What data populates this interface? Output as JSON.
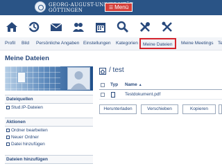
{
  "header": {
    "university_name_line1": "GEORG-AUGUST-UNIVERSITÄT",
    "university_name_line2": "GÖTTINGEN",
    "menu_label": "Menü"
  },
  "icon_nav": [
    "home-icon",
    "activity-icon",
    "messages-icon",
    "community-icon",
    "calendar-icon",
    "search-icon",
    "tools-icon",
    "admin-icon"
  ],
  "tabs": [
    "Profil",
    "Bild",
    "Persönliche Angaben",
    "Einstellungen",
    "Kategorien",
    "Meine Dateien",
    "Meine Meetings",
    "Te"
  ],
  "active_tab": "Meine Dateien",
  "page_title": "Meine Dateien",
  "sidebar": {
    "sections": [
      {
        "title": "Dateiquellen",
        "items": [
          "Stud.IP-Dateien"
        ]
      },
      {
        "title": "Aktionen",
        "items": [
          "Ordner bearbeiten",
          "Neuer Ordner",
          "Datei hinzufügen"
        ]
      },
      {
        "title": "Dateien hinzufügen",
        "items": []
      }
    ]
  },
  "main": {
    "breadcrumb": "/ test",
    "columns": {
      "typ": "Typ",
      "name": "Name"
    },
    "files": [
      {
        "name": "Testdokument.pdf"
      }
    ],
    "actions": [
      "Herunterladen",
      "Verschieben",
      "Kopieren",
      ""
    ]
  },
  "colors": {
    "brand_blue": "#2a5486",
    "menu_red": "#d43f3a",
    "highlight_red": "#d6232c",
    "text_blue": "#28497c"
  }
}
